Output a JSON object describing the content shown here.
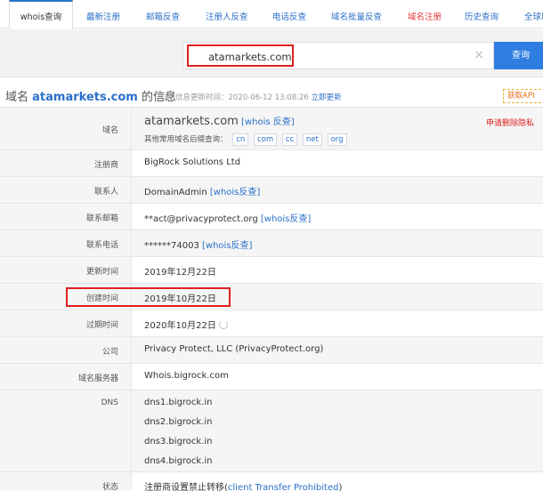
{
  "tabs": [
    {
      "label": "whois查询"
    },
    {
      "label": "最新注册"
    },
    {
      "label": "邮箱反查"
    },
    {
      "label": "注册人反查"
    },
    {
      "label": "电话反查"
    },
    {
      "label": "域名批量反查"
    },
    {
      "label": "域名注册"
    },
    {
      "label": "历史查询"
    },
    {
      "label": "全球域"
    }
  ],
  "search": {
    "value": "atamarkets.com",
    "clear_icon": "×",
    "button_label": "查询"
  },
  "header": {
    "prefix": "域名 ",
    "domain": "atamarkets.com",
    "suffix": " 的信息",
    "update_prefix": "以下信息更新时间：2020-06-12 13:08:26 ",
    "update_link": "立即更新",
    "api_label": "获取API"
  },
  "rows": {
    "domain": {
      "label": "域名",
      "value": "atamarkets.com",
      "links": "[whois 反查]",
      "other_suffix_label": "其他常用域名后缀查询：",
      "suffixes": [
        "cn",
        "com",
        "cc",
        "net",
        "org"
      ],
      "delete_privacy": "申请删除隐私"
    },
    "registrar": {
      "label": "注册商",
      "value": "BigRock Solutions Ltd"
    },
    "contact": {
      "label": "联系人",
      "value": "DomainAdmin ",
      "link": "[whois反查]"
    },
    "email": {
      "label": "联系邮箱",
      "value": "**act@privacyprotect.org ",
      "link": "[whois反查]"
    },
    "phone": {
      "label": "联系电话",
      "value": "******74003 ",
      "link": "[whois反查]"
    },
    "updated": {
      "label": "更新时间",
      "value": "2019年12月22日"
    },
    "created": {
      "label": "创建时间",
      "value": "2019年10月22日"
    },
    "expires": {
      "label": "过期时间",
      "value": "2020年10月22日"
    },
    "company": {
      "label": "公司",
      "value": "Privacy Protect, LLC (PrivacyProtect.org)"
    },
    "whois_server": {
      "label": "域名服务器",
      "value": "Whois.bigrock.com"
    },
    "dns": {
      "label": "DNS",
      "values": [
        "dns1.bigrock.in",
        "dns2.bigrock.in",
        "dns3.bigrock.in",
        "dns4.bigrock.in"
      ]
    },
    "status": {
      "label": "状态",
      "value": "注册商设置禁止转移(",
      "link": "client Transfer Prohibited",
      "close": ")"
    }
  }
}
